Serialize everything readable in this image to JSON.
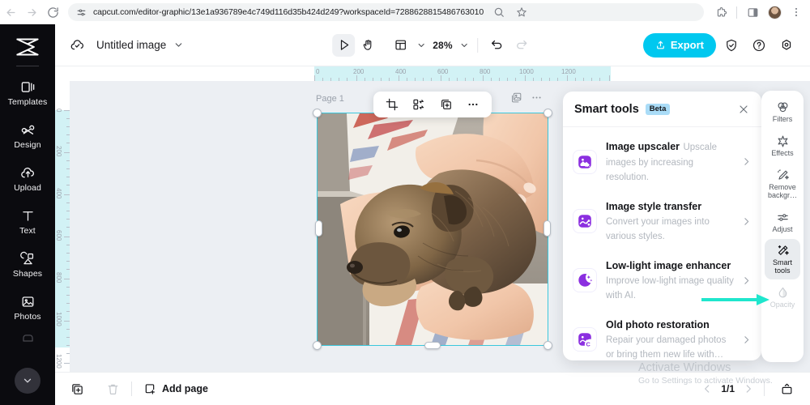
{
  "browser": {
    "url": "capcut.com/editor-graphic/13e1a936789e4c749d116d35b424d249?workspaceId=7288628815486763010",
    "back_icon": "back-arrow-icon",
    "forward_icon": "forward-arrow-icon",
    "reload_icon": "reload-icon",
    "site_settings_icon": "tune-icon",
    "zoom_icon": "search-zoom-icon",
    "bookmark_icon": "star-icon",
    "extensions_icon": "puzzle-icon",
    "sidepanel_icon": "side-panel-icon",
    "profile_icon": "avatar-icon",
    "menu_icon": "kebab-menu-icon"
  },
  "rail": {
    "logo": "capcut-logo",
    "items": [
      {
        "label": "Templates",
        "icon": "templates-icon"
      },
      {
        "label": "Design",
        "icon": "design-icon"
      },
      {
        "label": "Upload",
        "icon": "upload-icon"
      },
      {
        "label": "Text",
        "icon": "text-icon"
      },
      {
        "label": "Shapes",
        "icon": "shapes-icon"
      },
      {
        "label": "Photos",
        "icon": "photos-icon"
      }
    ],
    "scroll_icon": "chevron-down-icon"
  },
  "header": {
    "cloud_icon": "cloud-saved-icon",
    "title": "Untitled image",
    "title_caret": "chevron-down-icon",
    "tools": [
      {
        "name": "select-tool",
        "icon": "cursor-icon",
        "active": true
      },
      {
        "name": "hand-tool",
        "icon": "hand-icon",
        "active": false
      },
      {
        "name": "layout-tool",
        "icon": "layout-icon",
        "active": false
      }
    ],
    "layout_caret": "chevron-down-icon",
    "zoom_value": "28%",
    "zoom_caret": "chevron-down-icon",
    "undo_icon": "undo-icon",
    "redo_icon": "redo-icon",
    "export_label": "Export",
    "export_icon": "export-upload-icon",
    "export_color": "#00c8ef",
    "right_icons": [
      {
        "name": "shield-check-icon"
      },
      {
        "name": "help-circle-icon"
      },
      {
        "name": "settings-gear-icon"
      }
    ]
  },
  "canvas": {
    "page_label": "Page 1",
    "ruler_h_labels": [
      "0",
      "200",
      "400",
      "600",
      "800",
      "1000",
      "1200"
    ],
    "ruler_v_labels": [
      "0",
      "200",
      "400",
      "600",
      "800",
      "1000",
      "1200"
    ],
    "selection_color": "#3bc8dd",
    "float_toolbar": [
      {
        "name": "crop-icon"
      },
      {
        "name": "replace-icon"
      },
      {
        "name": "duplicate-icon"
      },
      {
        "name": "more-options-icon"
      }
    ],
    "side_icons": [
      {
        "name": "layers-icon"
      },
      {
        "name": "more-options-icon"
      }
    ],
    "artboard_alt": "puppy-held-in-hands-photo"
  },
  "panel": {
    "title": "Smart tools",
    "badge": "Beta",
    "badge_color": "#aadcf7",
    "close_icon": "close-icon",
    "items": [
      {
        "name": "Image upscaler",
        "desc": "Upscale images by increasing resolution.",
        "icon": "image-upscaler-4k-icon",
        "arrow": "chevron-right-icon"
      },
      {
        "name": "Image style transfer",
        "desc": "Convert your images into various styles.",
        "icon": "image-style-transfer-icon",
        "arrow": "chevron-right-icon"
      },
      {
        "name": "Low-light image enhancer",
        "desc": "Improve low-light image quality with AI.",
        "icon": "moon-sparkle-icon",
        "arrow": "chevron-right-icon"
      },
      {
        "name": "Old photo restoration",
        "desc": "Repair your damaged photos or bring them new life with…",
        "icon": "old-photo-restoration-icon",
        "arrow": "chevron-right-icon"
      }
    ]
  },
  "right_rail": {
    "items": [
      {
        "label": "Filters",
        "icon": "filters-icon",
        "state": "normal"
      },
      {
        "label": "Effects",
        "icon": "effects-icon",
        "state": "normal"
      },
      {
        "label": "Remove backgr…",
        "icon": "remove-background-icon",
        "state": "normal"
      },
      {
        "label": "Adjust",
        "icon": "adjust-sliders-icon",
        "state": "normal"
      },
      {
        "label": "Smart tools",
        "icon": "smart-tools-wand-icon",
        "state": "active"
      },
      {
        "label": "Opacity",
        "icon": "opacity-drop-icon",
        "state": "dim"
      }
    ],
    "annotation_arrow_color": "#1fe6cd"
  },
  "bottom": {
    "duplicate_page_icon": "duplicate-page-icon",
    "delete_page_icon": "trash-icon",
    "add_page_label": "Add page",
    "add_page_icon": "add-page-icon",
    "prev_icon": "chevron-left-icon",
    "page_indicator": "1/1",
    "next_icon": "chevron-right-icon",
    "present_icon": "present-icon"
  },
  "watermark": {
    "line1": "Activate Windows",
    "line2": "Go to Settings to activate Windows."
  }
}
